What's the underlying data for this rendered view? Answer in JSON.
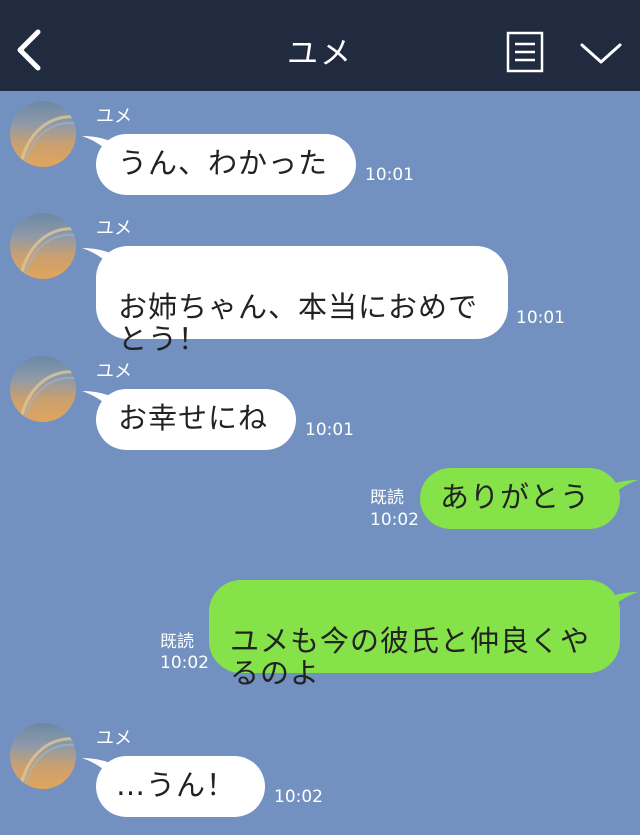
{
  "header": {
    "title": "ユメ",
    "back_icon": "chevron-left-icon",
    "menu_icon": "list-icon",
    "collapse_icon": "chevron-down-icon",
    "background": "#212b40"
  },
  "colors": {
    "chat_background": "#7291c0",
    "incoming_bubble": "#ffffff",
    "outgoing_bubble": "#85e249"
  },
  "messages": [
    {
      "sender": "ユメ",
      "text": "うん、わかった",
      "time": "10:01"
    },
    {
      "sender": "ユメ",
      "text": "お姉ちゃん、本当におめで\nとう！",
      "time": "10:01"
    },
    {
      "sender": "ユメ",
      "text": "お幸せにね",
      "time": "10:01"
    },
    {
      "sender": "me",
      "text": "ありがとう",
      "read": "既読",
      "time": "10:02"
    },
    {
      "sender": "me",
      "text": "ユメも今の彼氏と仲良くや\nるのよ",
      "read": "既読",
      "time": "10:02"
    },
    {
      "sender": "ユメ",
      "text": "…うん！",
      "time": "10:02"
    }
  ]
}
